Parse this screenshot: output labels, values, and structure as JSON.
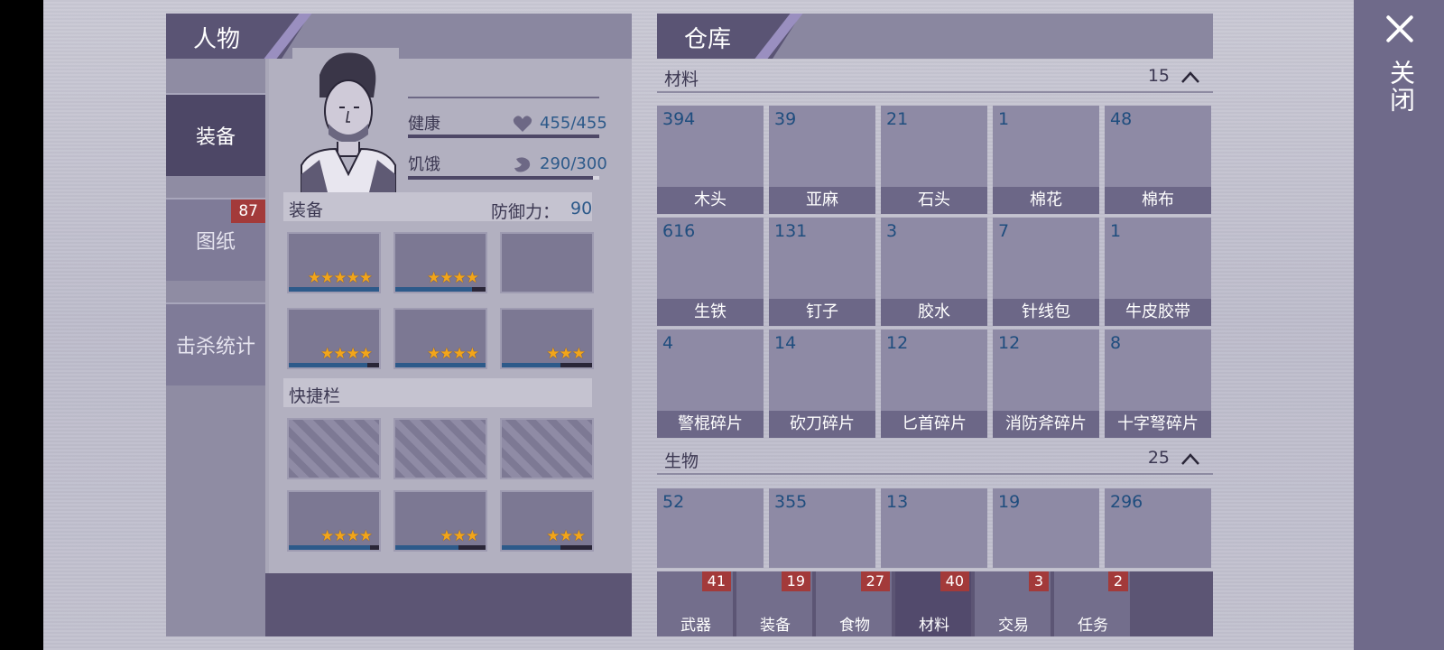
{
  "close": {
    "label": "关闭"
  },
  "character": {
    "title": "人物",
    "side_tabs": [
      {
        "label": "装备",
        "active": true
      },
      {
        "label": "图纸",
        "badge": "87"
      },
      {
        "label": "击杀统计"
      }
    ],
    "stats": {
      "health_label": "健康",
      "health_value": "455/455",
      "hunger_label": "饥饿",
      "hunger_value": "290/300",
      "hunger_fraction": 0.967
    },
    "equipment": {
      "label": "装备",
      "defense_label": "防御力：",
      "defense_value": "90",
      "slots": [
        {
          "icon": "helmet-icon",
          "stars": "★★★★★",
          "durability": 1.0
        },
        {
          "icon": "armor-icon",
          "stars": "★★★★",
          "durability": 0.85
        },
        {
          "icon": "jacket-icon",
          "stars": "",
          "durability": 0
        },
        {
          "icon": "gloves-icon",
          "stars": "★★★★",
          "durability": 0.87
        },
        {
          "icon": "pants-icon",
          "stars": "★★★★",
          "durability": 1.0
        },
        {
          "icon": "boots-icon",
          "stars": "★★★",
          "durability": 0.65
        }
      ]
    },
    "quickbar": {
      "label": "快捷栏",
      "slots": [
        {
          "icon": "empty-slot-icon",
          "stars": ""
        },
        {
          "icon": "empty-slot-icon",
          "stars": ""
        },
        {
          "icon": "empty-slot-icon",
          "stars": ""
        },
        {
          "icon": "baton-icon",
          "stars": "★★★★",
          "durability": 0.9
        },
        {
          "icon": "spear-icon",
          "stars": "★★★",
          "durability": 0.7
        },
        {
          "icon": "spiked-club-icon",
          "stars": "★★★",
          "durability": 0.65
        }
      ]
    }
  },
  "storage": {
    "title": "仓库",
    "materials": {
      "title": "材料",
      "count": "15",
      "items": [
        {
          "count": "394",
          "name": "木头"
        },
        {
          "count": "39",
          "name": "亚麻"
        },
        {
          "count": "21",
          "name": "石头"
        },
        {
          "count": "1",
          "name": "棉花"
        },
        {
          "count": "48",
          "name": "棉布"
        },
        {
          "count": "616",
          "name": "生铁"
        },
        {
          "count": "131",
          "name": "钉子"
        },
        {
          "count": "3",
          "name": "胶水"
        },
        {
          "count": "7",
          "name": "针线包"
        },
        {
          "count": "1",
          "name": "牛皮胶带"
        },
        {
          "count": "4",
          "name": "警棍碎片"
        },
        {
          "count": "14",
          "name": "砍刀碎片"
        },
        {
          "count": "12",
          "name": "匕首碎片"
        },
        {
          "count": "12",
          "name": "消防斧碎片"
        },
        {
          "count": "8",
          "name": "十字弩碎片"
        }
      ]
    },
    "creatures": {
      "title": "生物",
      "count": "25",
      "items": [
        {
          "count": "52"
        },
        {
          "count": "355"
        },
        {
          "count": "13"
        },
        {
          "count": "19"
        },
        {
          "count": "296"
        }
      ]
    },
    "bottom_tabs": [
      {
        "label": "武器",
        "badge": "41",
        "icon": "axe-icon"
      },
      {
        "label": "装备",
        "badge": "19",
        "icon": "shirt-icon"
      },
      {
        "label": "食物",
        "badge": "27",
        "icon": "meat-icon"
      },
      {
        "label": "材料",
        "badge": "40",
        "icon": "log-icon",
        "active": true
      },
      {
        "label": "交易",
        "badge": "3",
        "icon": "coin-icon"
      },
      {
        "label": "任务",
        "badge": "2",
        "icon": "key-icon"
      }
    ]
  },
  "colors": {
    "accent_blue": "#2d5a8a",
    "badge_red": "#a33a3a",
    "panel_dark": "#5c5574",
    "star": "#f2a51a"
  }
}
